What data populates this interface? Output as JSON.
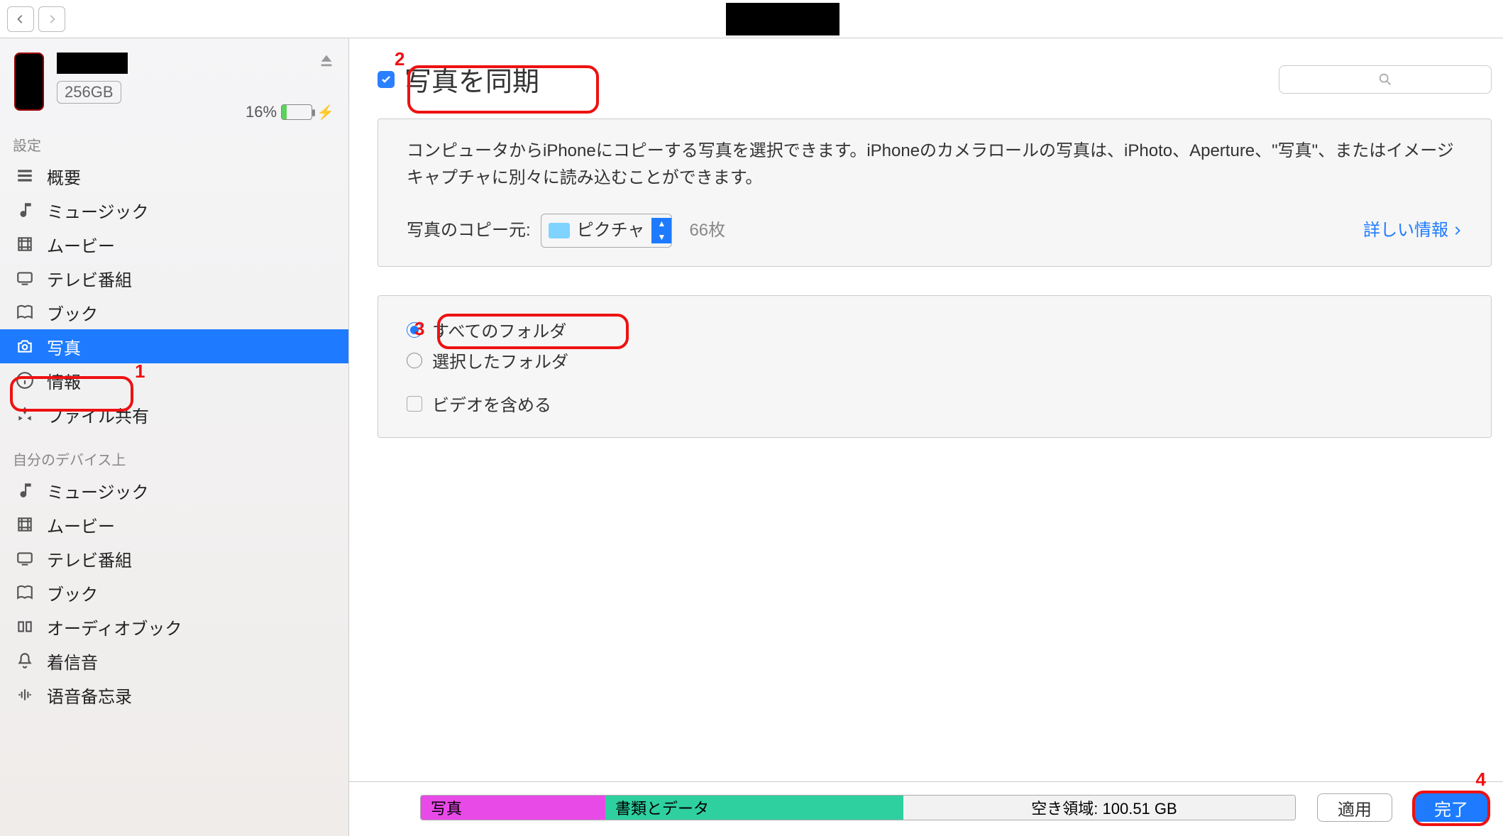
{
  "device": {
    "storage": "256GB",
    "battery_pct": "16%"
  },
  "sidebar": {
    "section1_label": "設定",
    "section2_label": "自分のデバイス上",
    "settings": [
      {
        "label": "概要"
      },
      {
        "label": "ミュージック"
      },
      {
        "label": "ムービー"
      },
      {
        "label": "テレビ番組"
      },
      {
        "label": "ブック"
      },
      {
        "label": "写真"
      },
      {
        "label": "情報"
      },
      {
        "label": "ファイル共有"
      }
    ],
    "ondevice": [
      {
        "label": "ミュージック"
      },
      {
        "label": "ムービー"
      },
      {
        "label": "テレビ番組"
      },
      {
        "label": "ブック"
      },
      {
        "label": "オーディオブック"
      },
      {
        "label": "着信音"
      },
      {
        "label": "语音备忘录"
      }
    ]
  },
  "main": {
    "sync_title": "写真を同期",
    "panel_text": "コンピュータからiPhoneにコピーする写真を選択できます。iPhoneのカメラロールの写真は、iPhoto、Aperture、\"写真\"、またはイメージキャプチャに別々に読み込むことができます。",
    "copyfrom_label": "写真のコピー元:",
    "copyfrom_value": "ピクチャ",
    "count_label": "66枚",
    "more_info": "詳しい情報",
    "radio_all": "すべてのフォルダ",
    "radio_selected": "選択したフォルダ",
    "chk_video": "ビデオを含める"
  },
  "footer": {
    "photos_seg": "写真",
    "docs_seg": "書類とデータ",
    "free_seg": "空き領域: 100.51 GB",
    "apply": "適用",
    "done": "完了"
  },
  "annotations": {
    "n1": "1",
    "n2": "2",
    "n3": "3",
    "n4": "4"
  }
}
